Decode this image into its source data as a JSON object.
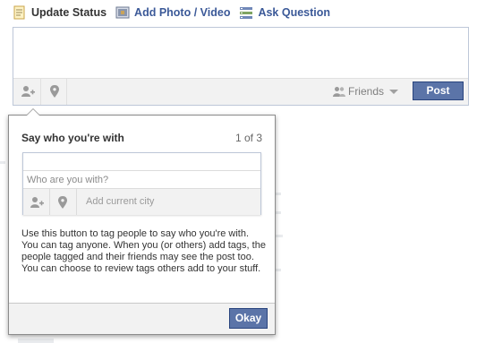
{
  "composer_tabs": [
    {
      "label": "Update Status",
      "icon": "status-icon",
      "active": true
    },
    {
      "label": "Add Photo / Video",
      "icon": "photo-icon",
      "active": false
    },
    {
      "label": "Ask Question",
      "icon": "question-icon",
      "active": false
    }
  ],
  "composer": {
    "audience_label": "Friends",
    "post_label": "Post"
  },
  "dialog": {
    "title": "Say who you're with",
    "counter": "1 of 3",
    "who_placeholder": "Who are you with?",
    "city_placeholder": "Add current city",
    "description": "Use this button to tag people to say who you're with. You can tag anyone. When you (or others) add tags, the people tagged and their friends may see the post too. You can choose to review tags others add to your stuff.",
    "ok_label": "Okay"
  },
  "colors": {
    "link": "#3b5998",
    "button_bg": "#5b74a8",
    "button_border": "#29447e",
    "bar_bg": "#f2f2f2"
  }
}
